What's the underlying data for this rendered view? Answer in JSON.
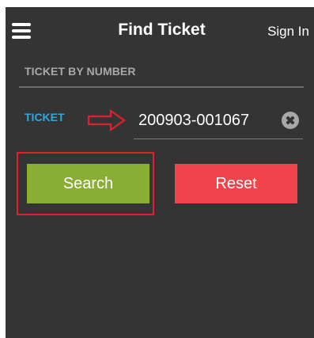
{
  "colors": {
    "background": "#343434",
    "accent_blue": "#2ea8de",
    "search_button": "#8aae34",
    "reset_button": "#f0434c",
    "annotation_red": "#e0212b"
  },
  "header": {
    "menu_icon": "hamburger-menu-icon",
    "title": "Find Ticket",
    "sign_in_label": "Sign In"
  },
  "section": {
    "label": "TICKET BY NUMBER"
  },
  "ticket": {
    "label": "TICKET",
    "value": "200903-001067",
    "clear_icon": "clear-circle-x-icon"
  },
  "buttons": {
    "search_label": "Search",
    "reset_label": "Reset"
  },
  "annotations": {
    "arrow_icon": "right-arrow-outline-icon"
  }
}
